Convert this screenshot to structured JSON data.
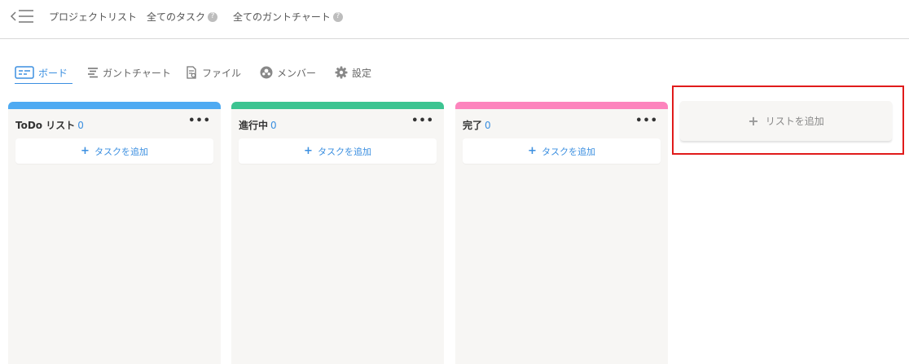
{
  "topnav": {
    "links": [
      {
        "label": "プロジェクトリスト"
      },
      {
        "label": "全てのタスク",
        "help": "?"
      },
      {
        "label": "全てのガントチャート",
        "help": "?"
      }
    ]
  },
  "tabs": [
    {
      "label": "ボード",
      "icon": "board-icon",
      "active": true
    },
    {
      "label": "ガントチャート",
      "icon": "gantt-icon"
    },
    {
      "label": "ファイル",
      "icon": "file-icon"
    },
    {
      "label": "メンバー",
      "icon": "member-icon"
    },
    {
      "label": "設定",
      "icon": "gear-icon"
    }
  ],
  "columns": [
    {
      "title": "ToDo リスト",
      "count": "0",
      "color": "#4eaaf2",
      "menu": "•••",
      "add_task": "タスクを追加",
      "plus": "+"
    },
    {
      "title": "進行中",
      "count": "0",
      "color": "#3cc491",
      "menu": "•••",
      "add_task": "タスクを追加",
      "plus": "+"
    },
    {
      "title": "完了",
      "count": "0",
      "color": "#fd84bd",
      "menu": "•••",
      "add_task": "タスクを追加",
      "plus": "+"
    }
  ],
  "add_list": {
    "plus": "+",
    "label": "リストを追加"
  },
  "colors": {
    "accent": "#3b8fe0",
    "highlight": "#e01b1b"
  }
}
